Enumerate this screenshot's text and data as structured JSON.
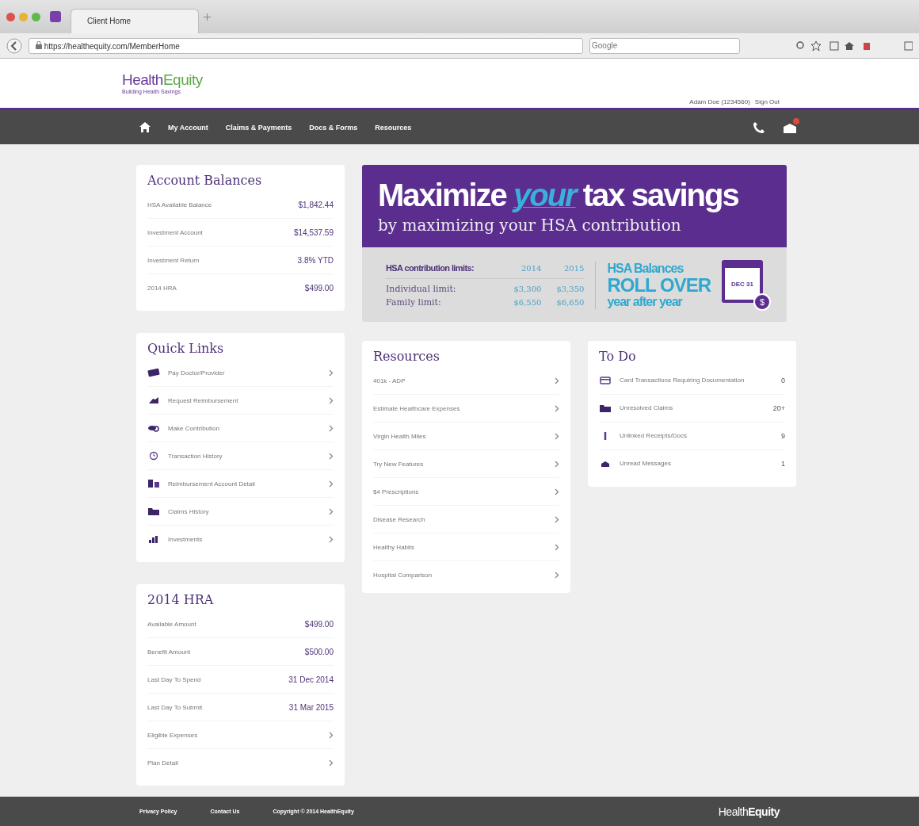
{
  "browser": {
    "tab_title": "Client Home",
    "url": "https://healthequity.com/MemberHome",
    "search": {
      "placeholder": "Google"
    }
  },
  "header": {
    "logo": {
      "first": "Health",
      "second": "Equity",
      "tagline": "Building Health Savings"
    },
    "user": "Adam Doe (1234560)",
    "sign_out": "Sign Out"
  },
  "nav": {
    "items": [
      "My Account",
      "Claims & Payments",
      "Docs & Forms",
      "Resources"
    ],
    "mail_badge": true
  },
  "account_balances": {
    "title": "Account Balances",
    "rows": [
      {
        "label": "HSA Available Balance",
        "value": "$1,842.44"
      },
      {
        "label": "Investment Account",
        "value": "$14,537.59"
      },
      {
        "label": "Investment Return",
        "value": "3.8% YTD"
      },
      {
        "label": "2014 HRA",
        "value": "$499.00"
      }
    ]
  },
  "quick_links": {
    "title": "Quick Links",
    "items": [
      "Pay Doctor/Provider",
      "Request Reimbursement",
      "Make Contribution",
      "Transaction History",
      "Reimbursement Account Detail",
      "Claims History",
      "Investments"
    ]
  },
  "hra": {
    "title": "2014 HRA",
    "rows": [
      {
        "kind": "value",
        "label": "Available Amount",
        "value": "$499.00"
      },
      {
        "kind": "value",
        "label": "Benefit Amount",
        "value": "$500.00"
      },
      {
        "kind": "value",
        "label": "Last Day To Spend",
        "value": "31 Dec 2014"
      },
      {
        "kind": "value",
        "label": "Last Day To Submit",
        "value": "31 Mar 2015"
      },
      {
        "kind": "link",
        "label": "Eligible Expenses"
      },
      {
        "kind": "link",
        "label": "Plan Detail"
      }
    ]
  },
  "banner": {
    "headline": [
      {
        "text": "Maximize",
        "accent": false
      },
      {
        "text": "your",
        "accent": true
      },
      {
        "text": "tax savings",
        "accent": false
      }
    ],
    "subline": "by maximizing your HSA contribution",
    "limits_title": "HSA contribution limits:",
    "years": [
      "2014",
      "2015"
    ],
    "limits": [
      {
        "label": "Individual limit:",
        "values": [
          "$3,300",
          "$3,350"
        ]
      },
      {
        "label": "Family limit:",
        "values": [
          "$6,550",
          "$6,650"
        ]
      }
    ],
    "rollover": [
      "HSA Balances",
      "ROLL OVER",
      "year after year"
    ],
    "calendar": "DEC 31",
    "coin": "$"
  },
  "resources": {
    "title": "Resources",
    "items": [
      "401k - ADP",
      "Estimate Healthcare Expenses",
      "Virgin Health Miles",
      "Try New Features",
      "$4 Prescriptions",
      "Disease Research",
      "Healthy Habits",
      "Hospital Comparison"
    ]
  },
  "todo": {
    "title": "To Do",
    "items": [
      {
        "label": "Card Transactions Requiring Documentation",
        "count": "0"
      },
      {
        "label": "Unresolved Claims",
        "count": "20+"
      },
      {
        "label": "Unlinked Receipts/Docs",
        "count": "9"
      },
      {
        "label": "Unread Messages",
        "count": "1"
      }
    ]
  },
  "footer": {
    "links": [
      "Privacy Policy",
      "Contact Us"
    ],
    "copyright": "Copyright © 2014 HealthEquity",
    "logo": {
      "first": "Health",
      "second": "Equity"
    }
  }
}
